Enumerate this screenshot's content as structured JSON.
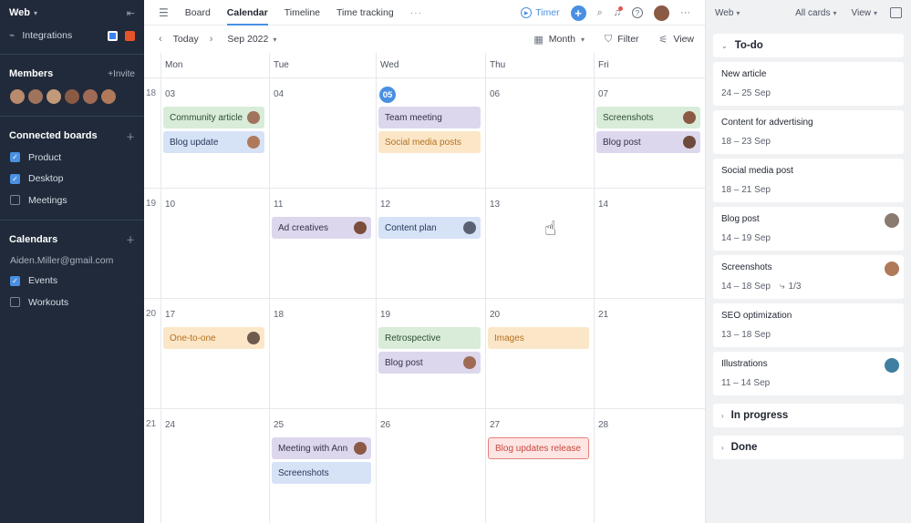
{
  "sidebar": {
    "workspace": "Web",
    "integrations_label": "Integrations",
    "members_title": "Members",
    "invite_label": "+Invite",
    "members": [
      {
        "color": "#b98a6e"
      },
      {
        "color": "#a0735c"
      },
      {
        "color": "#c29a7a"
      },
      {
        "color": "#8a5a44"
      },
      {
        "color": "#9f6b55"
      },
      {
        "color": "#b07a5a"
      }
    ],
    "boards_title": "Connected boards",
    "boards": [
      {
        "label": "Product",
        "checked": true
      },
      {
        "label": "Desktop",
        "checked": true
      },
      {
        "label": "Meetings",
        "checked": false
      }
    ],
    "calendars_title": "Calendars",
    "calendar_email": "Aiden.Miller@gmail.com",
    "calendars": [
      {
        "label": "Events",
        "checked": true
      },
      {
        "label": "Workouts",
        "checked": false
      }
    ]
  },
  "topnav": {
    "tabs": [
      "Board",
      "Calendar",
      "Timeline",
      "Time tracking"
    ],
    "active_tab": "Calendar",
    "more": "···",
    "timer": "Timer"
  },
  "toolbar": {
    "today": "Today",
    "month": "Sep 2022",
    "view_mode": "Month",
    "filter": "Filter",
    "view": "View"
  },
  "calendar": {
    "weekdays": [
      "Mon",
      "Tue",
      "Wed",
      "Thu",
      "Fri"
    ],
    "weeks": [
      {
        "num": "18",
        "days": [
          "03",
          "04",
          "05",
          "06",
          "07"
        ],
        "today_index": 2
      },
      {
        "num": "19",
        "days": [
          "10",
          "11",
          "12",
          "13",
          "14"
        ],
        "today_index": -1
      },
      {
        "num": "20",
        "days": [
          "17",
          "18",
          "19",
          "20",
          "21"
        ],
        "today_index": -1
      },
      {
        "num": "21",
        "days": [
          "24",
          "25",
          "26",
          "27",
          "28"
        ],
        "today_index": -1
      }
    ],
    "events": [
      {
        "week": 0,
        "day": 0,
        "slot": 0,
        "title": "Community article",
        "color": "green",
        "avatar": "#a0735c"
      },
      {
        "week": 0,
        "day": 0,
        "slot": 1,
        "title": "Blog update",
        "color": "blue",
        "avatar": "#b07a5a"
      },
      {
        "week": 0,
        "day": 2,
        "slot": 0,
        "title": "Team meeting",
        "color": "purple",
        "avatar": ""
      },
      {
        "week": 0,
        "day": 2,
        "slot": 1,
        "title": "Social media posts",
        "color": "orange",
        "avatar": ""
      },
      {
        "week": 0,
        "day": 4,
        "slot": 0,
        "title": "Screenshots",
        "color": "green",
        "avatar": "#8a5a44"
      },
      {
        "week": 0,
        "day": 4,
        "slot": 1,
        "title": "Blog post",
        "color": "purple",
        "avatar": "#6e4a3a"
      },
      {
        "week": 1,
        "day": 1,
        "slot": 0,
        "title": "Ad creatives",
        "color": "purple",
        "avatar": "#7a4e3a"
      },
      {
        "week": 1,
        "day": 2,
        "slot": 0,
        "title": "Content plan",
        "color": "blue",
        "avatar": "#5a6170"
      },
      {
        "week": 2,
        "day": 0,
        "slot": 0,
        "title": "One-to-one",
        "color": "orange",
        "avatar": "#6e5a4e"
      },
      {
        "week": 2,
        "day": 2,
        "slot": 0,
        "title": "Retrospective",
        "color": "green",
        "avatar": ""
      },
      {
        "week": 2,
        "day": 2,
        "slot": 1,
        "title": "Blog post",
        "color": "purple",
        "avatar": "#9f6b55"
      },
      {
        "week": 2,
        "day": 3,
        "slot": 0,
        "title": "Images",
        "color": "orange",
        "avatar": ""
      },
      {
        "week": 3,
        "day": 1,
        "slot": 0,
        "title": "Meeting with Ann",
        "color": "purple",
        "avatar": "#8a5a44"
      },
      {
        "week": 3,
        "day": 1,
        "slot": 1,
        "title": "Screenshots",
        "color": "blue",
        "avatar": ""
      },
      {
        "week": 3,
        "day": 3,
        "slot": 0,
        "title": "Blog updates release",
        "color": "redout",
        "avatar": ""
      }
    ]
  },
  "panel": {
    "workspace": "Web",
    "filter": "All cards",
    "view": "View",
    "todo_title": "To-do",
    "cards": [
      {
        "title": "New article",
        "dates": "24 – 25 Sep",
        "avatar": "",
        "subtasks": ""
      },
      {
        "title": "Content for advertising",
        "dates": "18 – 23 Sep",
        "avatar": "",
        "subtasks": ""
      },
      {
        "title": "Social media post",
        "dates": "18 – 21 Sep",
        "avatar": "",
        "subtasks": ""
      },
      {
        "title": "Blog post",
        "dates": "14 – 19 Sep",
        "avatar": "#8a7a70",
        "subtasks": ""
      },
      {
        "title": "Screenshots",
        "dates": "14 – 18 Sep",
        "avatar": "#b07a5a",
        "subtasks": "1/3"
      },
      {
        "title": "SEO optimization",
        "dates": "13 – 18 Sep",
        "avatar": "",
        "subtasks": ""
      },
      {
        "title": "Illustrations",
        "dates": "11 – 14 Sep",
        "avatar": "#3f7fa0",
        "subtasks": ""
      }
    ],
    "inprogress_title": "In progress",
    "done_title": "Done"
  }
}
